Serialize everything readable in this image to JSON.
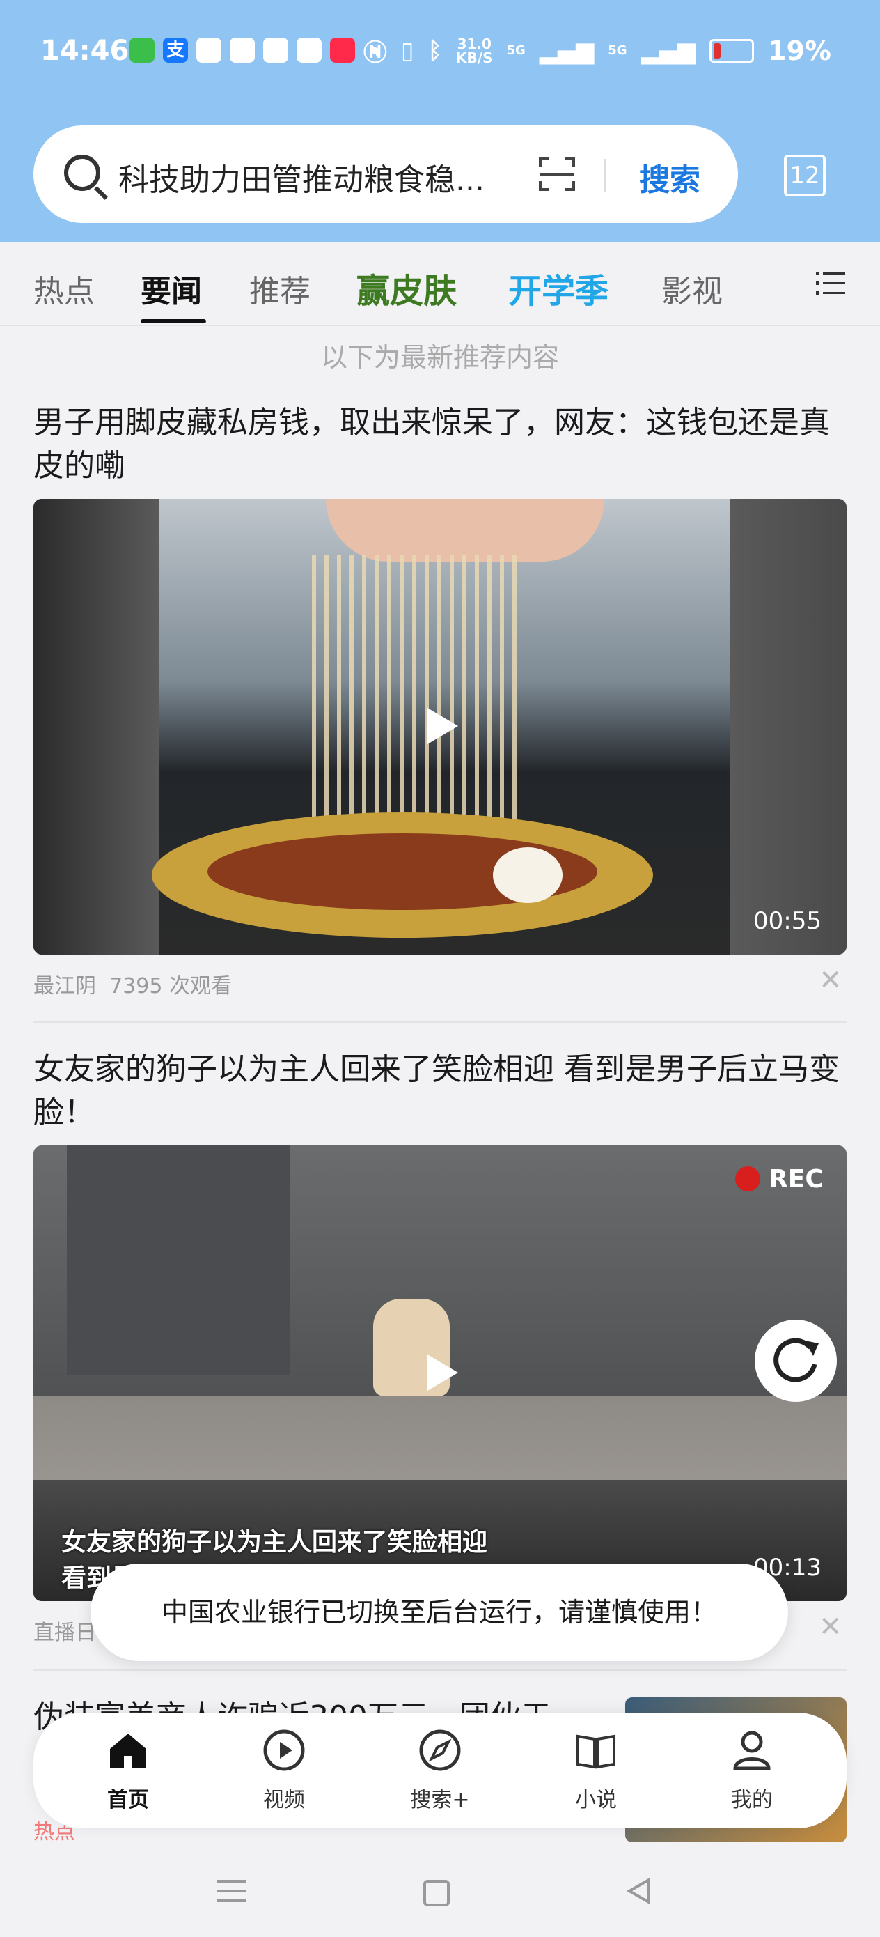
{
  "status_bar": {
    "time": "14:46",
    "net_speed": "31.0",
    "net_unit": "KB/S",
    "signal1": "5G",
    "signal2": "5G",
    "battery": "19%",
    "battery_level": 0.19
  },
  "search": {
    "query": "科技助力田管推动粮食稳...",
    "button_label": "搜索",
    "tab_count": "12"
  },
  "tabs": [
    {
      "label": "热点",
      "active": false
    },
    {
      "label": "要闻",
      "active": true
    },
    {
      "label": "推荐",
      "active": false
    },
    {
      "label": "赢皮肤",
      "active": false,
      "color": "#3e7a22"
    },
    {
      "label": "开学季",
      "active": false,
      "color": "#21a6e8"
    },
    {
      "label": "影视",
      "active": false
    }
  ],
  "feed": {
    "notice": "以下为最新推荐内容",
    "items": [
      {
        "title": "男子用脚皮藏私房钱，取出来惊呆了，网友：这钱包还是真皮的嘞",
        "duration": "00:55",
        "source": "最江阴",
        "views": "7395 次观看"
      },
      {
        "title": "女友家的狗子以为主人回来了笑脸相迎 看到是男子后立马变脸！",
        "rec_label": "REC",
        "caption_line1": "女友家的狗子以为主人回来了笑脸相迎",
        "caption_line2": "看到是男子后立马变脸！",
        "duration": "00:13",
        "source": "直播日"
      },
      {
        "title": "伪装富美商人诈骗近300万元，团伙于",
        "source": "热点"
      }
    ]
  },
  "toast": "中国农业银行已切换至后台运行，请谨慎使用！",
  "bottom_nav": [
    {
      "label": "首页",
      "icon": "home-icon",
      "active": true
    },
    {
      "label": "视频",
      "icon": "play-circle-icon",
      "active": false
    },
    {
      "label": "搜索+",
      "icon": "compass-icon",
      "active": false
    },
    {
      "label": "小说",
      "icon": "book-icon",
      "active": false
    },
    {
      "label": "我的",
      "icon": "user-icon",
      "active": false
    }
  ]
}
